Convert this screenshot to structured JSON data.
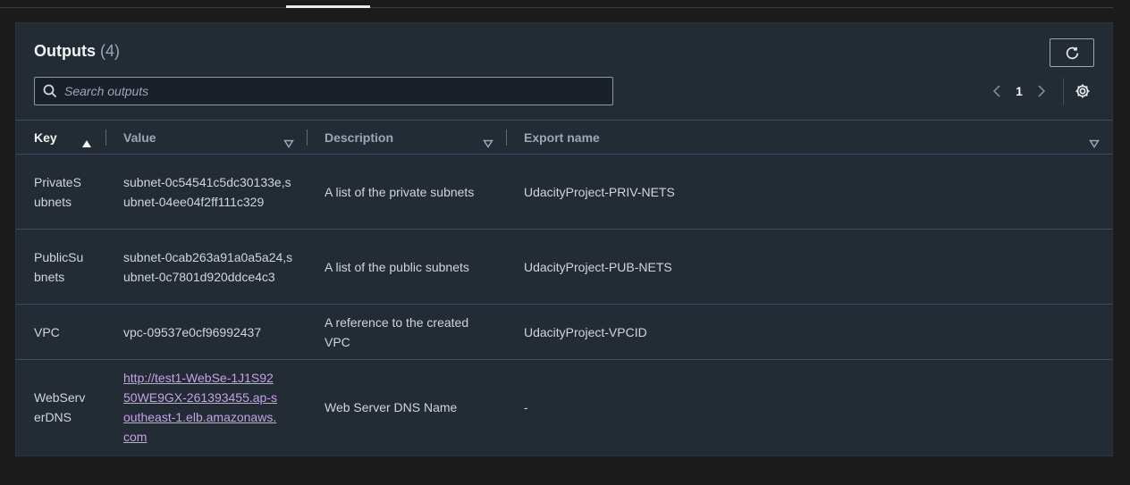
{
  "panel": {
    "title": "Outputs",
    "count": "(4)"
  },
  "search": {
    "placeholder": "Search outputs",
    "value": ""
  },
  "pagination": {
    "current_page": "1"
  },
  "table": {
    "columns": [
      "Key",
      "Value",
      "Description",
      "Export name"
    ],
    "rows": [
      {
        "key": "PrivateSubnets",
        "value": "subnet-0c54541c5dc30133e,subnet-04ee04f2ff111c329",
        "description": "A list of the private subnets",
        "export": "UdacityProject-PRIV-NETS"
      },
      {
        "key": "PublicSubnets",
        "value": "subnet-0cab263a91a0a5a24,subnet-0c7801d920ddce4c3",
        "description": "A list of the public subnets",
        "export": "UdacityProject-PUB-NETS"
      },
      {
        "key": "VPC",
        "value": "vpc-09537e0cf96992437",
        "description": "A reference to the created VPC",
        "export": "UdacityProject-VPCID"
      },
      {
        "key": "WebServerDNS",
        "value": "http://test1-WebSe-1J1S9250WE9GX-261393455.ap-southeast-1.elb.amazonaws.com",
        "description": "Web Server DNS Name",
        "export": "-"
      }
    ]
  },
  "icons": {
    "refresh": "refresh-icon",
    "search": "search-icon",
    "prev": "chevron-left-icon",
    "next": "chevron-right-icon",
    "settings": "gear-icon",
    "sort_asc": "sort-ascending-icon",
    "sort_filter": "sort-indicator-icon"
  },
  "colors": {
    "background": "#1b1b1b",
    "panel": "#232b35",
    "link": "#c7a0e8",
    "text": "#d1d5db",
    "muted": "#9ba7b6"
  }
}
